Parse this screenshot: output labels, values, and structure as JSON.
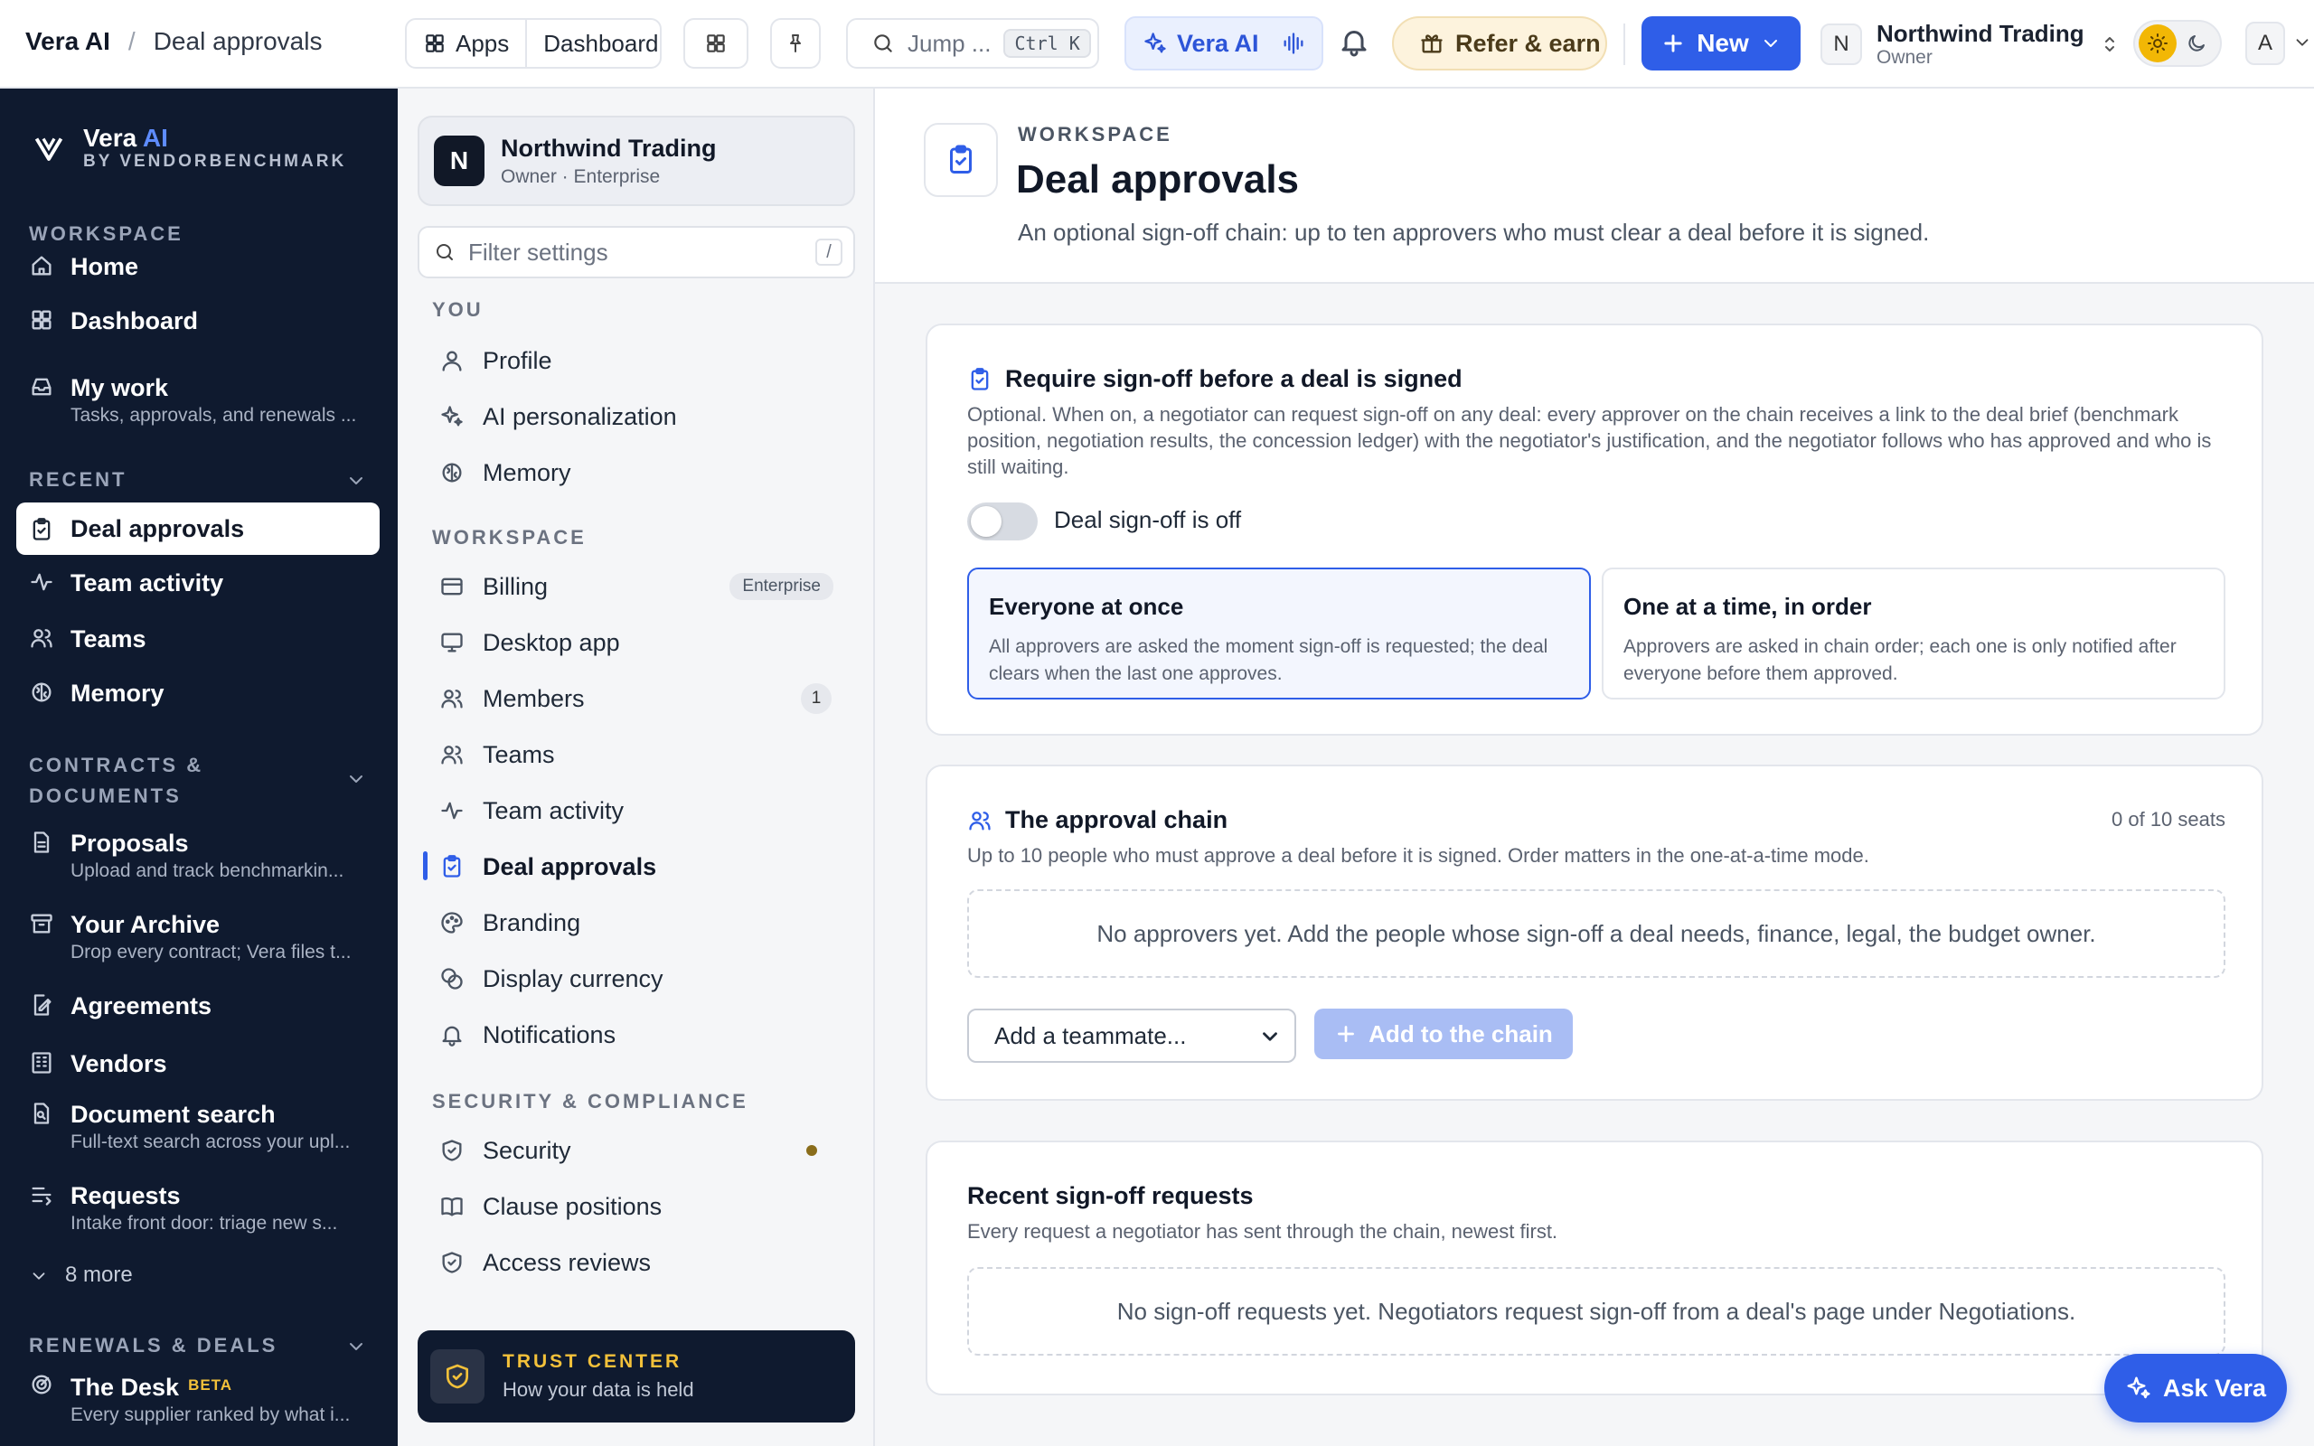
{
  "topbar": {
    "app_name": "Vera AI",
    "page_name": "Deal approvals",
    "apps_label": "Apps",
    "dashboard_label": "Dashboard",
    "search_placeholder": "Jump ...",
    "search_shortcut": "Ctrl K",
    "vera_label": "Vera AI",
    "refer_label": "Refer & earn",
    "new_label": "New",
    "org_initial": "N",
    "org_name": "Northwind Trading",
    "org_role": "Owner",
    "user_initial": "A"
  },
  "nav": {
    "brand": "Vera",
    "brand_accent": "AI",
    "brand_sub": "BY VENDORBENCHMARK",
    "workspace_heading": "WORKSPACE",
    "recent_heading": "RECENT",
    "contracts_heading_1": "CONTRACTS &",
    "contracts_heading_2": "DOCUMENTS",
    "renewals_heading": "RENEWALS & DEALS",
    "home": "Home",
    "dashboard": "Dashboard",
    "my_work": "My work",
    "my_work_desc": "Tasks, approvals, and renewals ...",
    "deal_approvals": "Deal approvals",
    "team_activity": "Team activity",
    "teams": "Teams",
    "memory": "Memory",
    "proposals": "Proposals",
    "proposals_desc": "Upload and track benchmarkin...",
    "archive": "Your Archive",
    "archive_desc": "Drop every contract; Vera files t...",
    "agreements": "Agreements",
    "vendors": "Vendors",
    "doc_search": "Document search",
    "doc_search_desc": "Full-text search across your upl...",
    "requests": "Requests",
    "requests_desc": "Intake front door: triage new s...",
    "more": "8 more",
    "desk": "The Desk",
    "desk_badge": "BETA",
    "desk_desc": "Every supplier ranked by what i..."
  },
  "settings": {
    "org_initial": "N",
    "org_name": "Northwind Trading",
    "org_plan": "Owner · Enterprise",
    "filter_placeholder": "Filter settings",
    "filter_key": "/",
    "you_heading": "YOU",
    "profile": "Profile",
    "ai_personalization": "AI personalization",
    "memory": "Memory",
    "workspace_heading": "WORKSPACE",
    "billing": "Billing",
    "billing_badge": "Enterprise",
    "desktop_app": "Desktop app",
    "members": "Members",
    "members_count": "1",
    "teams": "Teams",
    "team_activity": "Team activity",
    "deal_approvals": "Deal approvals",
    "branding": "Branding",
    "display_currency": "Display currency",
    "notifications": "Notifications",
    "security_heading": "SECURITY & COMPLIANCE",
    "security": "Security",
    "clause_positions": "Clause positions",
    "access_reviews": "Access reviews",
    "trust_title": "TRUST CENTER",
    "trust_sub": "How your data is held"
  },
  "main": {
    "eyebrow": "WORKSPACE",
    "title": "Deal approvals",
    "subtitle": "An optional sign-off chain: up to ten approvers who must clear a deal before it is signed.",
    "signoff": {
      "heading": "Require sign-off before a deal is signed",
      "description": "Optional. When on, a negotiator can request sign-off on any deal: every approver on the chain receives a link to the deal brief (benchmark position, negotiation results, the concession ledger) with the negotiator's justification, and the negotiator follows who has approved and who is still waiting.",
      "toggle_label": "Deal sign-off is off",
      "toggle_on": false,
      "option_parallel_title": "Everyone at once",
      "option_parallel_desc": "All approvers are asked the moment sign-off is requested; the deal clears when the last one approves.",
      "option_sequential_title": "One at a time, in order",
      "option_sequential_desc": "Approvers are asked in chain order; each one is only notified after everyone before them approved.",
      "selected_option": "Everyone at once"
    },
    "chain": {
      "heading": "The approval chain",
      "seats": "0 of 10 seats",
      "description": "Up to 10 people who must approve a deal before it is signed. Order matters in the one-at-a-time mode.",
      "empty": "No approvers yet. Add the people whose sign-off a deal needs, finance, legal, the budget owner.",
      "select_value": "Add a teammate...",
      "add_label": "Add to the chain"
    },
    "requests": {
      "heading": "Recent sign-off requests",
      "description": "Every request a negotiator has sent through the chain, newest first.",
      "empty": "No sign-off requests yet. Negotiators request sign-off from a deal's page under Negotiations."
    },
    "ask_label": "Ask Vera"
  },
  "colors": {
    "accent": "#2f5ee8",
    "nav_bg": "#0f1a2f",
    "gold": "#f3c13a"
  }
}
